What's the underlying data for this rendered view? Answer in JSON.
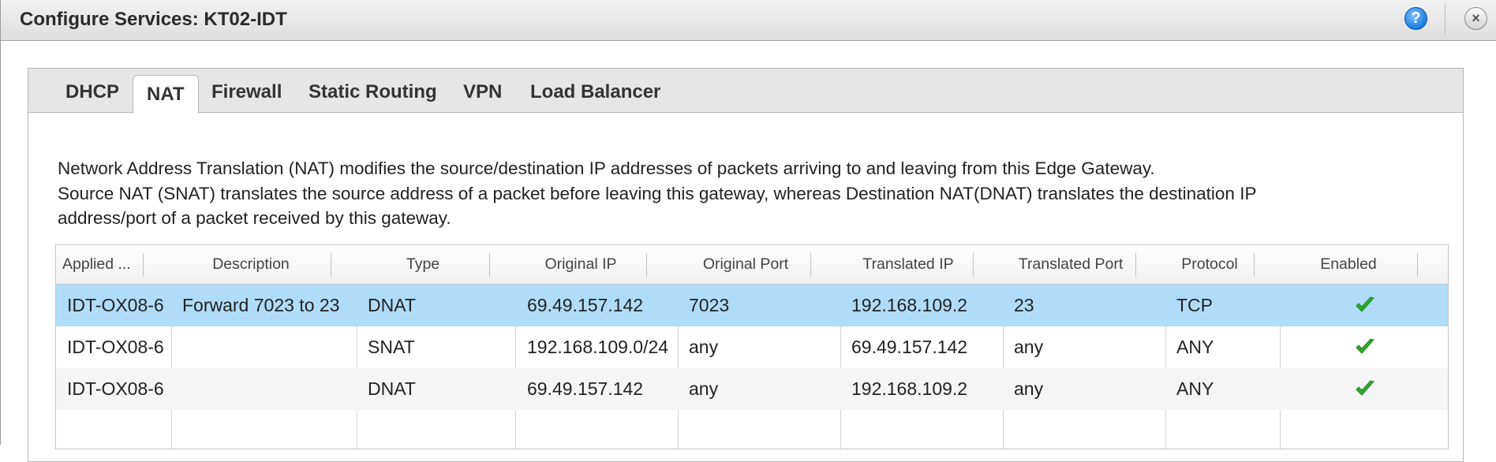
{
  "window": {
    "title": "Configure Services: KT02-IDT",
    "help_label": "?",
    "close_label": "×"
  },
  "tabs": [
    {
      "label": "DHCP",
      "active": false
    },
    {
      "label": "NAT",
      "active": true
    },
    {
      "label": "Firewall",
      "active": false
    },
    {
      "label": "Static Routing",
      "active": false
    },
    {
      "label": "VPN",
      "active": false
    },
    {
      "label": "Load Balancer",
      "active": false
    }
  ],
  "description": {
    "line1": "Network Address Translation (NAT) modifies the source/destination IP addresses of packets arriving to and leaving from this Edge Gateway.",
    "line2": "Source NAT (SNAT) translates the source address of a packet before leaving this gateway, whereas Destination NAT(DNAT)  translates the destination IP",
    "line3": "address/port of a packet received by this gateway."
  },
  "table": {
    "columns": [
      "Applied ...",
      "Description",
      "Type",
      "Original IP",
      "Original Port",
      "Translated IP",
      "Translated Port",
      "Protocol",
      "Enabled"
    ],
    "rows": [
      {
        "applied": "IDT-OX08-6",
        "description": "Forward 7023 to 23",
        "type": "DNAT",
        "original_ip": "69.49.157.142",
        "original_port": "7023",
        "translated_ip": "192.168.109.2",
        "translated_port": "23",
        "protocol": "TCP",
        "enabled": true,
        "selected": true
      },
      {
        "applied": "IDT-OX08-6",
        "description": "",
        "type": "SNAT",
        "original_ip": "192.168.109.0/24",
        "original_port": "any",
        "translated_ip": "69.49.157.142",
        "translated_port": "any",
        "protocol": "ANY",
        "enabled": true,
        "selected": false
      },
      {
        "applied": "IDT-OX08-6",
        "description": "",
        "type": "DNAT",
        "original_ip": "69.49.157.142",
        "original_port": "any",
        "translated_ip": "192.168.109.2",
        "translated_port": "any",
        "protocol": "ANY",
        "enabled": true,
        "selected": false
      }
    ]
  },
  "colors": {
    "selected_row": "#b0dcf8",
    "check_green": "#2ea82e",
    "help_blue": "#1a7de0"
  }
}
